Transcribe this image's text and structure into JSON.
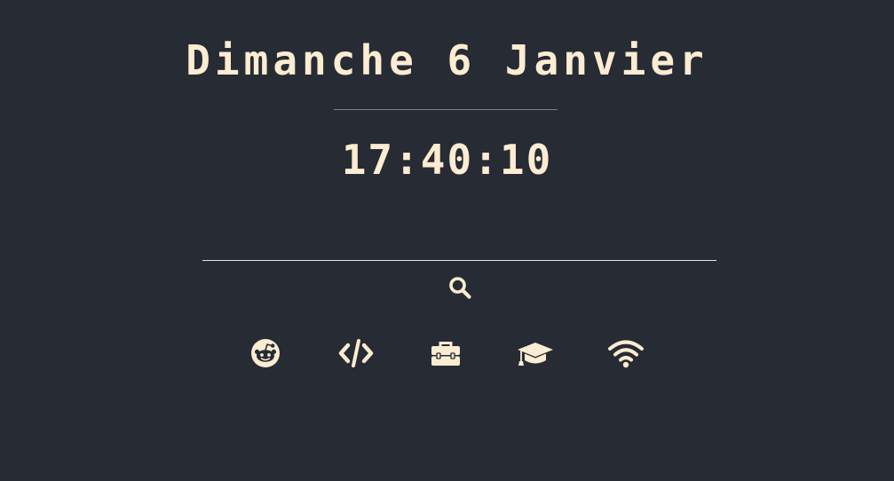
{
  "header": {
    "date": "Dimanche 6 Janvier",
    "time": "17:40:10"
  },
  "search": {
    "value": "",
    "placeholder": "",
    "icon": "search-icon"
  },
  "links": [
    {
      "icon": "reddit-icon"
    },
    {
      "icon": "code-icon"
    },
    {
      "icon": "toolbox-icon"
    },
    {
      "icon": "graduation-cap-icon"
    },
    {
      "icon": "wifi-icon"
    }
  ],
  "colors": {
    "background": "#272b34",
    "foreground": "#fcecd2",
    "divider": "#7d8086"
  }
}
